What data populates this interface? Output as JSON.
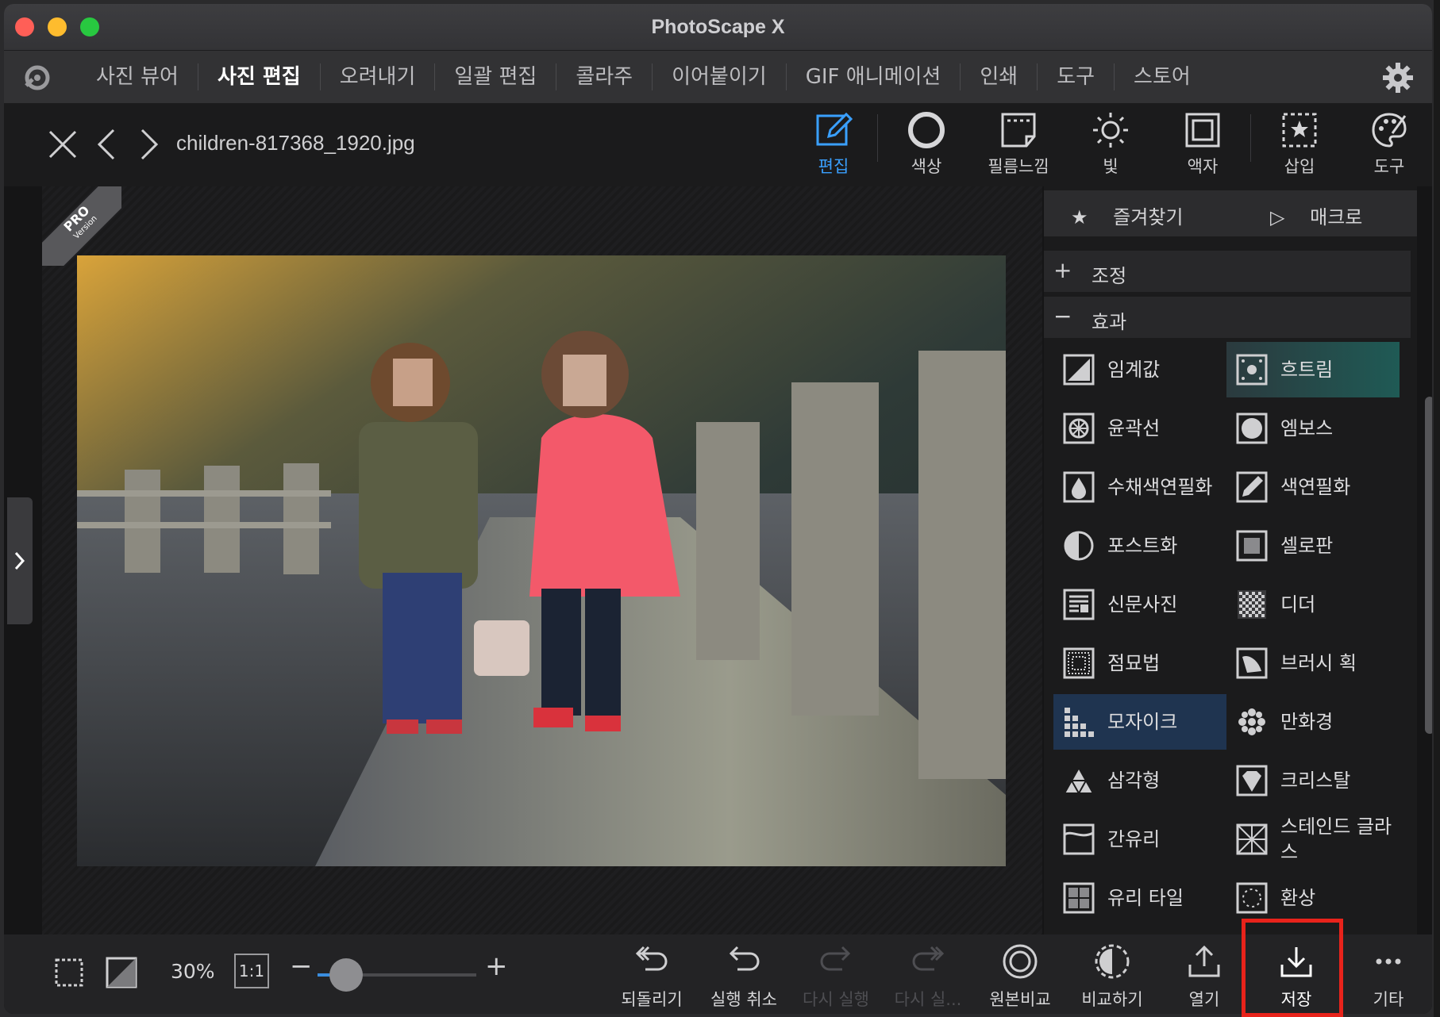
{
  "window": {
    "title": "PhotoScape X"
  },
  "menu": {
    "tabs": [
      "사진 뷰어",
      "사진 편집",
      "오려내기",
      "일괄 편집",
      "콜라주",
      "이어붙이기",
      "GIF 애니메이션",
      "인쇄",
      "도구",
      "스토어"
    ],
    "active_tab": "사진 편집"
  },
  "toolbar": {
    "filename": "children-817368_1920.jpg",
    "tools": [
      {
        "label": "편집",
        "icon": "edit-icon",
        "active": true
      },
      {
        "label": "색상",
        "icon": "color-circle-icon"
      },
      {
        "label": "필름느낌",
        "icon": "film-icon"
      },
      {
        "label": "빛",
        "icon": "sun-icon"
      },
      {
        "label": "액자",
        "icon": "frame-icon"
      },
      {
        "label": "삽입",
        "icon": "insert-star-icon"
      },
      {
        "label": "도구",
        "icon": "palette-icon"
      }
    ],
    "accent_color": "#3aa0ff"
  },
  "badge": {
    "line1": "PRO",
    "line2": "Version"
  },
  "panel": {
    "favorites": "즐겨찾기",
    "macro": "매크로",
    "section_adjust": {
      "symbol": "+",
      "label": "조정"
    },
    "section_effects": {
      "symbol": "−",
      "label": "효과"
    },
    "effects": [
      {
        "left": "임계값",
        "right": "흐트림"
      },
      {
        "left": "윤곽선",
        "right": "엠보스"
      },
      {
        "left": "수채색연필화",
        "right": "색연필화"
      },
      {
        "left": "포스트화",
        "right": "셀로판"
      },
      {
        "left": "신문사진",
        "right": "디더"
      },
      {
        "left": "점묘법",
        "right": "브러시 획"
      },
      {
        "left": "모자이크",
        "right": "만화경"
      },
      {
        "left": "삼각형",
        "right": "크리스탈"
      },
      {
        "left": "간유리",
        "right": "스테인드 글라스"
      },
      {
        "left": "유리 타일",
        "right": "환상"
      }
    ]
  },
  "bottom": {
    "zoom": "30%",
    "one_to_one": "1:1",
    "zoom_level": 0.18,
    "actions": [
      {
        "label": "되돌리기",
        "icon": "revert-icon",
        "enabled": true
      },
      {
        "label": "실행 취소",
        "icon": "undo-icon",
        "enabled": true
      },
      {
        "label": "다시 실행",
        "icon": "redo-icon",
        "enabled": false
      },
      {
        "label": "다시 실...",
        "icon": "redo-all-icon",
        "enabled": false
      },
      {
        "label": "원본비교",
        "icon": "compare-original-icon",
        "enabled": true
      },
      {
        "label": "비교하기",
        "icon": "compare-icon",
        "enabled": true
      },
      {
        "label": "열기",
        "icon": "open-icon",
        "enabled": true
      },
      {
        "label": "저장",
        "icon": "save-icon",
        "enabled": true,
        "highlighted": true
      },
      {
        "label": "기타",
        "icon": "more-icon",
        "enabled": true
      }
    ],
    "highlight_color": "#e8231b"
  }
}
